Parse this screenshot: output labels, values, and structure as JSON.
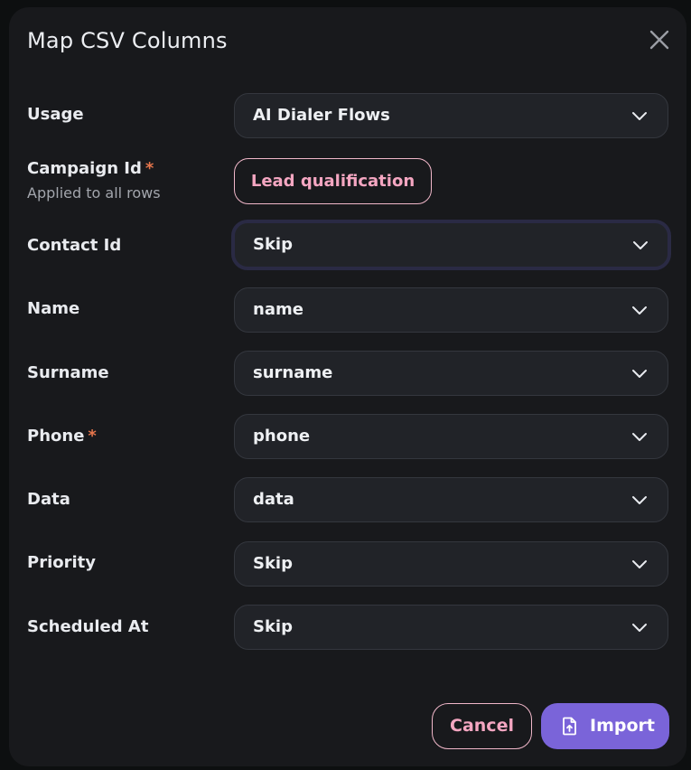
{
  "dialog": {
    "title": "Map CSV Columns",
    "close_icon": "close-icon"
  },
  "fields": {
    "usage": {
      "label": "Usage",
      "value": "AI Dialer Flows"
    },
    "campaign_id": {
      "label": "Campaign Id",
      "required_mark": "*",
      "hint": "Applied to all rows",
      "value": "Lead qualification"
    },
    "contact_id": {
      "label": "Contact Id",
      "value": "Skip"
    },
    "name": {
      "label": "Name",
      "value": "name"
    },
    "surname": {
      "label": "Surname",
      "value": "surname"
    },
    "phone": {
      "label": "Phone",
      "required_mark": "*",
      "value": "phone"
    },
    "data": {
      "label": "Data",
      "value": "data"
    },
    "priority": {
      "label": "Priority",
      "value": "Skip"
    },
    "scheduled_at": {
      "label": "Scheduled At",
      "value": "Skip"
    }
  },
  "footer": {
    "cancel_label": "Cancel",
    "import_label": "Import",
    "import_icon": "file-upload-icon"
  },
  "colors": {
    "dialog_bg": "#18191c",
    "field_bg": "#212328",
    "accent_pink": "#f4a6c1",
    "required": "#e6764c",
    "primary": "#7a64d9"
  }
}
